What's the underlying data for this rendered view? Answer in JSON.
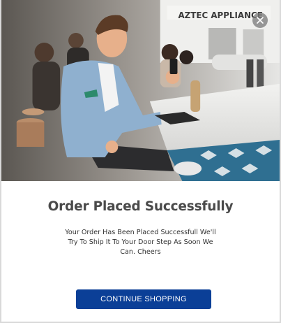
{
  "hero": {
    "sign_text": "AZTEC APPLIANCE"
  },
  "close_label": "×",
  "title": "Order Placed Successfully",
  "message": "Your Order Has Been Placed Successfull We'll Try To Ship It To Your Door Step As Soon We Can. Cheers",
  "cta_label": "CONTINUE SHOPPING",
  "colors": {
    "cta": "#0b3f97",
    "title": "#4a4a4a"
  }
}
